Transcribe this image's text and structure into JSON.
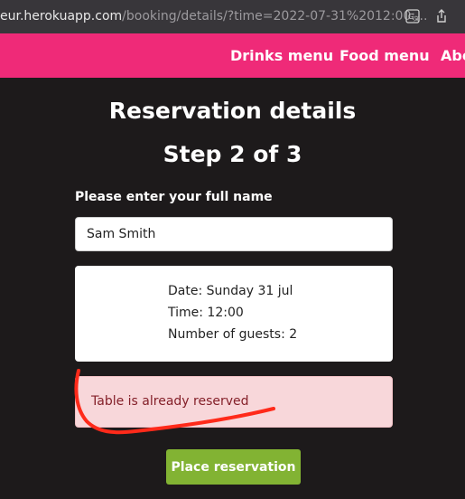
{
  "browser": {
    "url_host": "eur.herokuapp.com",
    "url_path": "/booking/details/?time=2022-07-31%2012:00:..."
  },
  "nav": {
    "items": [
      "Drinks menu",
      "Food menu",
      "Abo"
    ]
  },
  "page": {
    "title": "Reservation details",
    "step": "Step 2 of 3"
  },
  "form": {
    "name_label": "Please enter your full name",
    "name_value": "Sam Smith"
  },
  "summary": {
    "date": "Date: Sunday 31 jul",
    "time": "Time: 12:00",
    "guests": "Number of guests: 2"
  },
  "alert": {
    "message": "Table is already reserved"
  },
  "actions": {
    "submit_label": "Place reservation"
  },
  "colors": {
    "background": "#1d1a1b",
    "nav": "#ef2a78",
    "alert_bg": "#f8d7da",
    "alert_text": "#842029",
    "button": "#82b333",
    "annotation": "#ff2a1a"
  },
  "icons": [
    "translate-icon",
    "share-icon"
  ]
}
